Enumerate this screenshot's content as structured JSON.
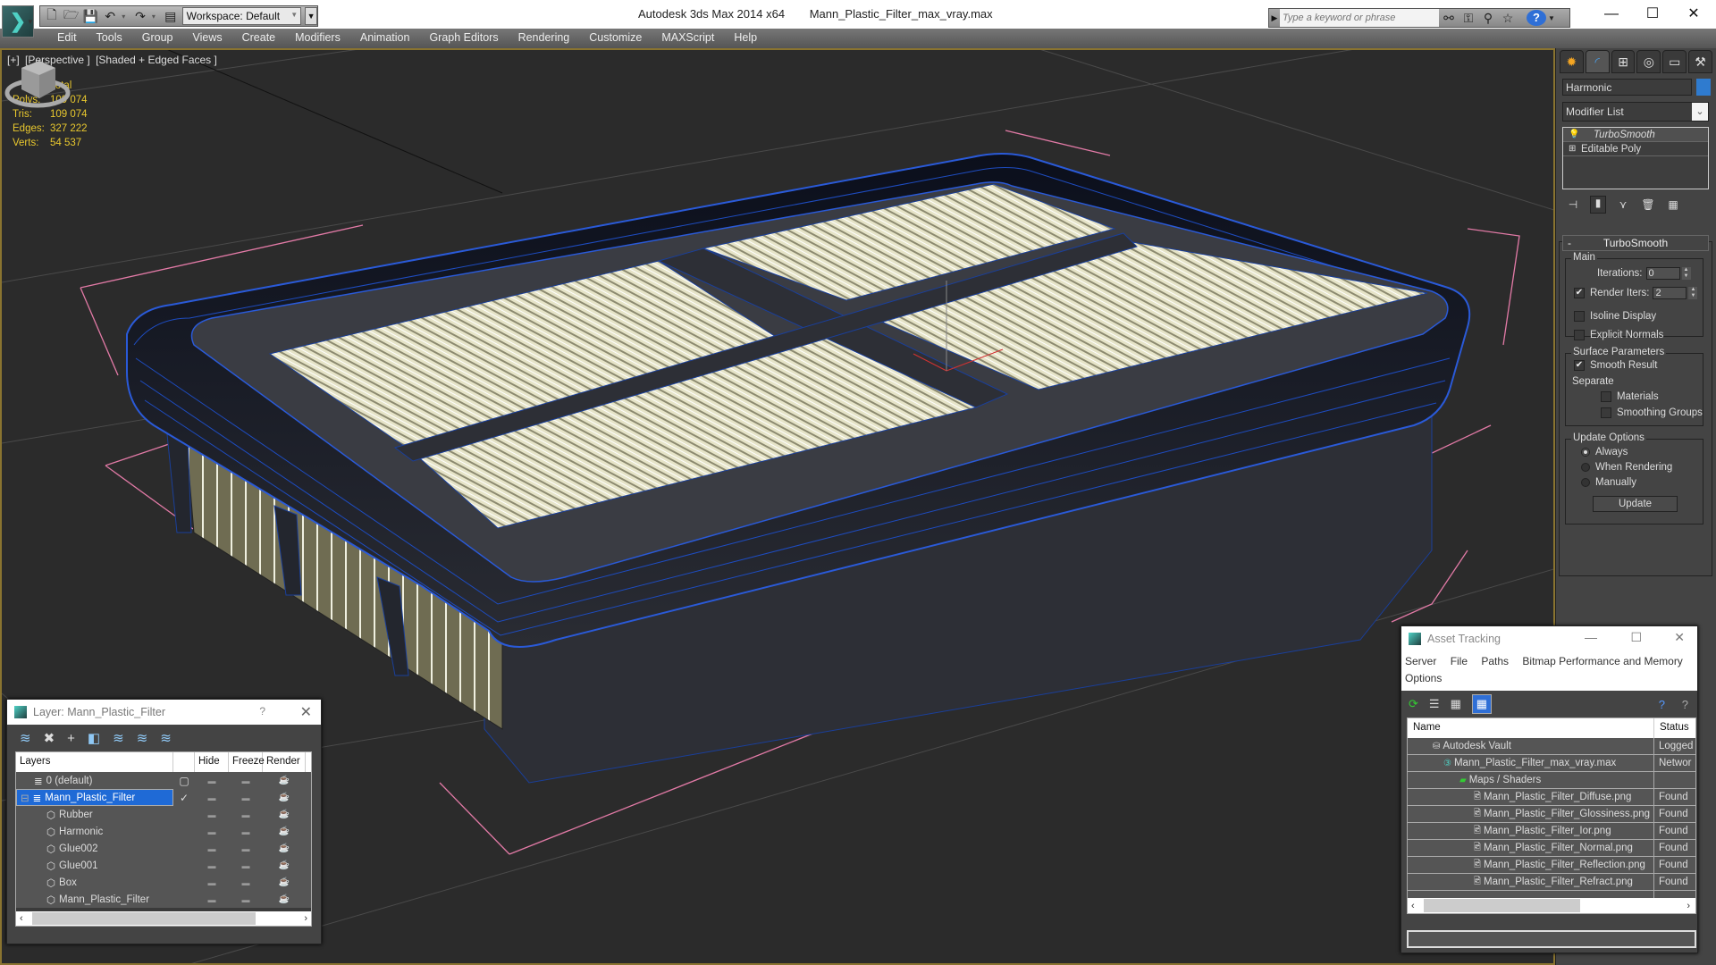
{
  "app": {
    "title": "Autodesk 3ds Max  2014 x64",
    "file": "Mann_Plastic_Filter_max_vray.max",
    "workspace": "Workspace: Default",
    "search_placeholder": "Type a keyword or phrase"
  },
  "menu": [
    "Edit",
    "Tools",
    "Group",
    "Views",
    "Create",
    "Modifiers",
    "Animation",
    "Graph Editors",
    "Rendering",
    "Customize",
    "MAXScript",
    "Help"
  ],
  "viewport": {
    "labels": [
      "[+]",
      "[Perspective ]",
      "[Shaded + Edged Faces ]"
    ],
    "stats": {
      "header": "Total",
      "rows": [
        {
          "key": "Polys:",
          "value": "109 074"
        },
        {
          "key": "Tris:",
          "value": "109 074"
        },
        {
          "key": "Edges:",
          "value": "327 222"
        },
        {
          "key": "Verts:",
          "value": "54 537"
        }
      ]
    }
  },
  "command_panel": {
    "object_name": "Harmonic",
    "object_color": "#2f7bcf",
    "modifier_list": "Modifier List",
    "stack": [
      {
        "label": "TurboSmooth",
        "selected": true
      },
      {
        "label": "Editable Poly",
        "selected": false
      }
    ],
    "rollout": {
      "title": "TurboSmooth",
      "main_group": "Main",
      "iterations_label": "Iterations:",
      "iterations_value": "0",
      "render_iters_label": "Render Iters:",
      "render_iters_value": "2",
      "render_iters_checked": true,
      "isoline_label": "Isoline Display",
      "explicit_normals_label": "Explicit Normals",
      "surface_group": "Surface Parameters",
      "smooth_result_label": "Smooth Result",
      "separate_label": "Separate",
      "materials_label": "Materials",
      "smoothing_groups_label": "Smoothing Groups",
      "update_group": "Update Options",
      "update_options": [
        "Always",
        "When Rendering",
        "Manually"
      ],
      "update_selected": "Always",
      "update_button": "Update"
    }
  },
  "layer_dialog": {
    "title": "Layer: Mann_Plastic_Filter",
    "help": "?",
    "columns": [
      "Layers",
      "",
      "Hide",
      "Freeze",
      "Render"
    ],
    "rows": [
      {
        "name": "0 (default)",
        "indent": 1,
        "type": "layer",
        "current": "box",
        "selected": false
      },
      {
        "name": "Mann_Plastic_Filter",
        "indent": 0,
        "type": "layer",
        "current": "check",
        "selected": true,
        "expanded": true
      },
      {
        "name": "Rubber",
        "indent": 2,
        "type": "object",
        "current": "",
        "selected": false
      },
      {
        "name": "Harmonic",
        "indent": 2,
        "type": "object",
        "current": "",
        "selected": false
      },
      {
        "name": "Glue002",
        "indent": 2,
        "type": "object",
        "current": "",
        "selected": false
      },
      {
        "name": "Glue001",
        "indent": 2,
        "type": "object",
        "current": "",
        "selected": false
      },
      {
        "name": "Box",
        "indent": 2,
        "type": "object",
        "current": "",
        "selected": false
      },
      {
        "name": "Mann_Plastic_Filter",
        "indent": 2,
        "type": "object",
        "current": "",
        "selected": false
      }
    ]
  },
  "asset_tracking": {
    "title": "Asset Tracking",
    "menu": [
      "Server",
      "File",
      "Paths",
      "Bitmap Performance and Memory",
      "Options"
    ],
    "columns": {
      "name": "Name",
      "status": "Status"
    },
    "rows": [
      {
        "name": "Autodesk Vault",
        "status": "Logged",
        "indent": 1,
        "icon": "vault"
      },
      {
        "name": "Mann_Plastic_Filter_max_vray.max",
        "status": "Networ",
        "indent": 2,
        "icon": "max-file"
      },
      {
        "name": "Maps / Shaders",
        "status": "",
        "indent": 3,
        "icon": "maps"
      },
      {
        "name": "Mann_Plastic_Filter_Diffuse.png",
        "status": "Found",
        "indent": 4,
        "icon": "png"
      },
      {
        "name": "Mann_Plastic_Filter_Glossiness.png",
        "status": "Found",
        "indent": 4,
        "icon": "png"
      },
      {
        "name": "Mann_Plastic_Filter_Ior.png",
        "status": "Found",
        "indent": 4,
        "icon": "png"
      },
      {
        "name": "Mann_Plastic_Filter_Normal.png",
        "status": "Found",
        "indent": 4,
        "icon": "png"
      },
      {
        "name": "Mann_Plastic_Filter_Reflection.png",
        "status": "Found",
        "indent": 4,
        "icon": "png"
      },
      {
        "name": "Mann_Plastic_Filter_Refract.png",
        "status": "Found",
        "indent": 4,
        "icon": "png"
      }
    ]
  }
}
